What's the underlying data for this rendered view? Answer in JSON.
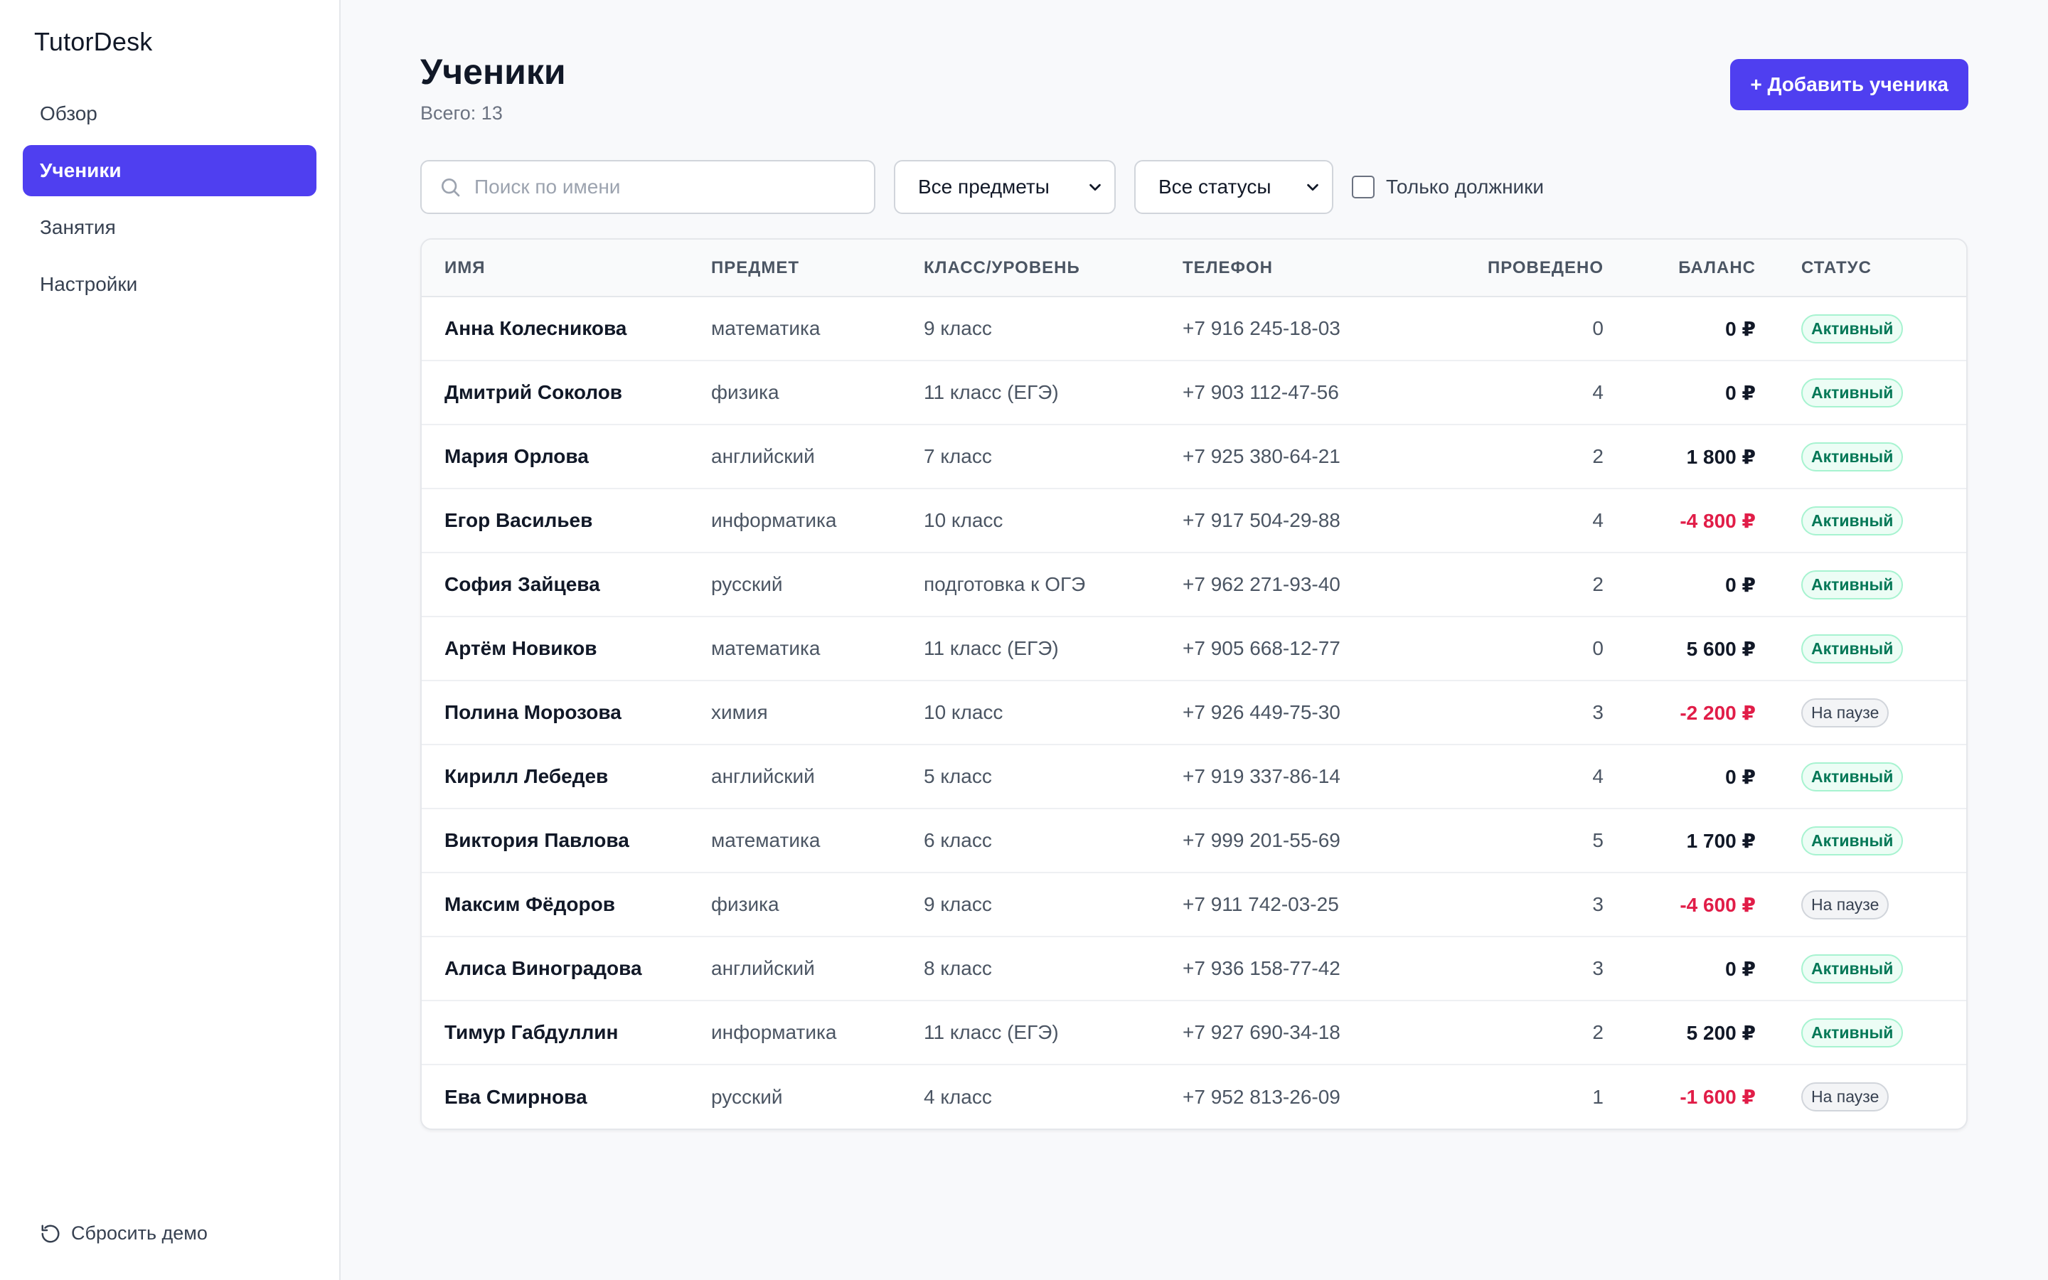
{
  "app": {
    "brand": "TutorDesk"
  },
  "sidebar": {
    "items": [
      {
        "label": "Обзор",
        "active": false
      },
      {
        "label": "Ученики",
        "active": true
      },
      {
        "label": "Занятия",
        "active": false
      },
      {
        "label": "Настройки",
        "active": false
      }
    ],
    "reset_label": "Сбросить демо",
    "reset_icon": "reset-icon"
  },
  "header": {
    "title": "Ученики",
    "subtitle": "Всего: 13",
    "add_button_label": "+ Добавить ученика"
  },
  "filters": {
    "search_placeholder": "Поиск по имени",
    "search_value": "",
    "subject_select": "Все предметы",
    "status_select": "Все статусы",
    "debtors_only_label": "Только должники",
    "debtors_only_checked": false
  },
  "colors": {
    "accent": "#4f3ff0",
    "negative_balance": "#e11d48",
    "active_badge": "#047857"
  },
  "table": {
    "columns": [
      "Имя",
      "Предмет",
      "Класс/уровень",
      "Телефон",
      "Проведено",
      "Баланс",
      "Статус"
    ],
    "rows": [
      {
        "name": "Анна Колесникова",
        "subject": "математика",
        "level": "9 класс",
        "phone": "+7 916 245-18-03",
        "done": "0",
        "balance": "0 ₽",
        "negative": false,
        "status": "Активный",
        "status_type": "active"
      },
      {
        "name": "Дмитрий Соколов",
        "subject": "физика",
        "level": "11 класс (ЕГЭ)",
        "phone": "+7 903 112-47-56",
        "done": "4",
        "balance": "0 ₽",
        "negative": false,
        "status": "Активный",
        "status_type": "active"
      },
      {
        "name": "Мария Орлова",
        "subject": "английский",
        "level": "7 класс",
        "phone": "+7 925 380-64-21",
        "done": "2",
        "balance": "1 800 ₽",
        "negative": false,
        "status": "Активный",
        "status_type": "active"
      },
      {
        "name": "Егор Васильев",
        "subject": "информатика",
        "level": "10 класс",
        "phone": "+7 917 504-29-88",
        "done": "4",
        "balance": "-4 800 ₽",
        "negative": true,
        "status": "Активный",
        "status_type": "active"
      },
      {
        "name": "София Зайцева",
        "subject": "русский",
        "level": "подготовка к ОГЭ",
        "phone": "+7 962 271-93-40",
        "done": "2",
        "balance": "0 ₽",
        "negative": false,
        "status": "Активный",
        "status_type": "active"
      },
      {
        "name": "Артём Новиков",
        "subject": "математика",
        "level": "11 класс (ЕГЭ)",
        "phone": "+7 905 668-12-77",
        "done": "0",
        "balance": "5 600 ₽",
        "negative": false,
        "status": "Активный",
        "status_type": "active"
      },
      {
        "name": "Полина Морозова",
        "subject": "химия",
        "level": "10 класс",
        "phone": "+7 926 449-75-30",
        "done": "3",
        "balance": "-2 200 ₽",
        "negative": true,
        "status": "На паузе",
        "status_type": "paused"
      },
      {
        "name": "Кирилл Лебедев",
        "subject": "английский",
        "level": "5 класс",
        "phone": "+7 919 337-86-14",
        "done": "4",
        "balance": "0 ₽",
        "negative": false,
        "status": "Активный",
        "status_type": "active"
      },
      {
        "name": "Виктория Павлова",
        "subject": "математика",
        "level": "6 класс",
        "phone": "+7 999 201-55-69",
        "done": "5",
        "balance": "1 700 ₽",
        "negative": false,
        "status": "Активный",
        "status_type": "active"
      },
      {
        "name": "Максим Фёдоров",
        "subject": "физика",
        "level": "9 класс",
        "phone": "+7 911 742-03-25",
        "done": "3",
        "balance": "-4 600 ₽",
        "negative": true,
        "status": "На паузе",
        "status_type": "paused"
      },
      {
        "name": "Алиса Виноградова",
        "subject": "английский",
        "level": "8 класс",
        "phone": "+7 936 158-77-42",
        "done": "3",
        "balance": "0 ₽",
        "negative": false,
        "status": "Активный",
        "status_type": "active"
      },
      {
        "name": "Тимур Габдуллин",
        "subject": "информатика",
        "level": "11 класс (ЕГЭ)",
        "phone": "+7 927 690-34-18",
        "done": "2",
        "balance": "5 200 ₽",
        "negative": false,
        "status": "Активный",
        "status_type": "active"
      },
      {
        "name": "Ева Смирнова",
        "subject": "русский",
        "level": "4 класс",
        "phone": "+7 952 813-26-09",
        "done": "1",
        "balance": "-1 600 ₽",
        "negative": true,
        "status": "На паузе",
        "status_type": "paused"
      }
    ]
  }
}
